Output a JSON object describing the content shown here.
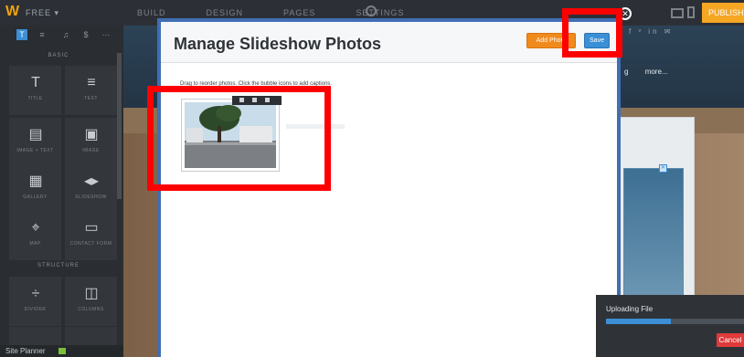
{
  "topbar": {
    "plan_label": "FREE ▾",
    "tabs": [
      "BUILD",
      "DESIGN",
      "PAGES",
      "SETTINGS"
    ],
    "publish_label": "PUBLISH"
  },
  "sidebar": {
    "toolbar": [
      "T",
      "≡",
      "♫",
      "$",
      "⋯"
    ],
    "basic_label": "BASIC",
    "structure_label": "STRUCTURE",
    "tiles": [
      {
        "icon": "T",
        "label": "TITLE"
      },
      {
        "icon": "≡",
        "label": "TEXT"
      },
      {
        "icon": "▤",
        "label": "IMAGE + TEXT"
      },
      {
        "icon": "▣",
        "label": "IMAGE"
      },
      {
        "icon": "▦",
        "label": "GALLERY"
      },
      {
        "icon": "◂▸",
        "label": "SLIDESHOW"
      },
      {
        "icon": "⌖",
        "label": "MAP"
      },
      {
        "icon": "▭",
        "label": "CONTACT FORM"
      },
      {
        "icon": "÷",
        "label": "DIVIDER"
      },
      {
        "icon": "◫",
        "label": "COLUMNS"
      }
    ],
    "site_planner_label": "Site Planner"
  },
  "canvas": {
    "social": "f  ᵛ  in  ✉",
    "nav": [
      "g",
      "more..."
    ]
  },
  "modal": {
    "title": "Manage Slideshow Photos",
    "add_photos_label": "Add Photo",
    "save_label": "Save",
    "instructions": "Drag to reorder photos. Click the bubble icons to add captions."
  },
  "upload": {
    "title": "Uploading File",
    "progress_percent": 47,
    "cancel_label": "Cancel"
  },
  "colors": {
    "highlight": "#ff0000",
    "accent_blue": "#3b8fd6",
    "add_orange": "#f08a1c"
  }
}
